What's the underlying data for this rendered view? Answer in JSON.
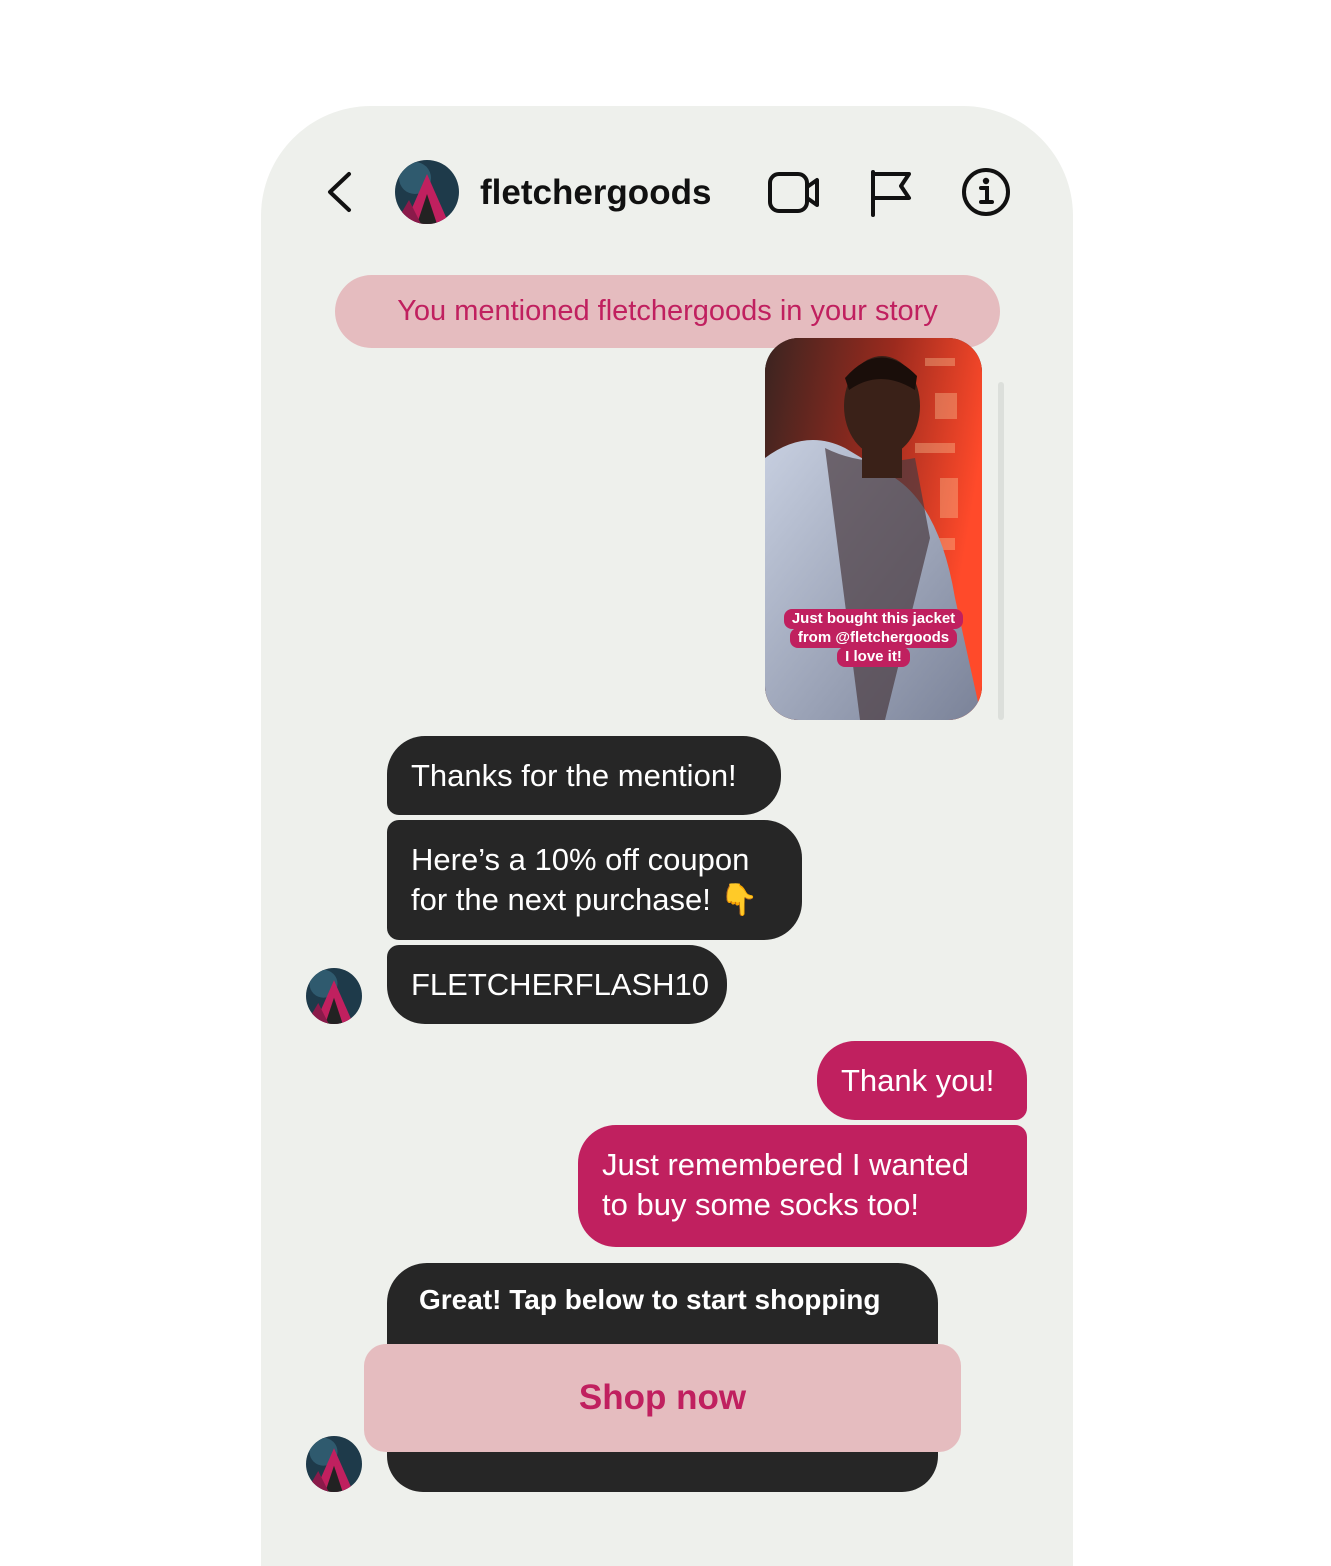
{
  "header": {
    "username": "fletchergoods"
  },
  "mention_banner": "You mentioned fletchergoods in your story",
  "story": {
    "caption_lines": [
      "Just bought this jacket",
      "from @fletchergoods",
      "I love it!"
    ]
  },
  "messages": [
    {
      "from": "business",
      "text": "Thanks for the mention!"
    },
    {
      "from": "business",
      "lines": [
        "Here’s a 10% off coupon",
        "for the next purchase! 👇"
      ]
    },
    {
      "from": "business",
      "text": "FLETCHERFLASH10"
    },
    {
      "from": "user",
      "text": "Thank you!"
    },
    {
      "from": "user",
      "lines": [
        "Just remembered I wanted",
        "to buy some socks too!"
      ]
    }
  ],
  "shop_card": {
    "text": "Great! Tap below to start shopping",
    "button_label": "Shop now"
  },
  "colors": {
    "accent": "#c0205f",
    "accent_light": "#e5bcbf",
    "bubble_dark": "#262626",
    "screen_bg": "#eef0ec"
  },
  "icons": [
    "chevron-left-icon",
    "video-camera-icon",
    "flag-icon",
    "info-icon"
  ]
}
